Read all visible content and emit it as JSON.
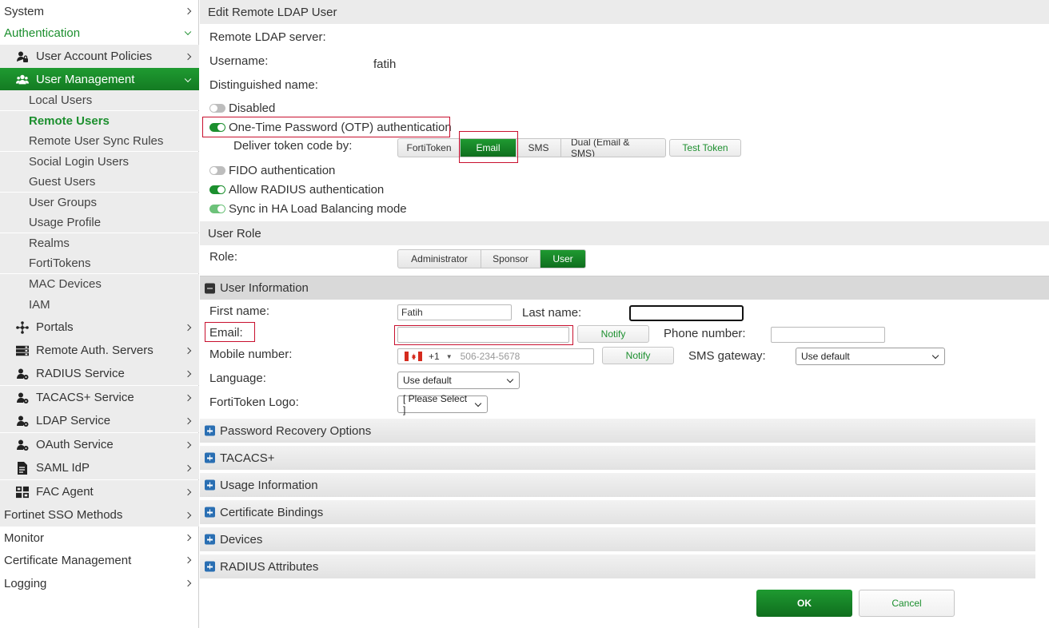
{
  "sidebar": {
    "system": "System",
    "authentication": "Authentication",
    "user_account_policies": "User Account Policies",
    "user_management": "User Management",
    "leaves": [
      "Local Users",
      "Remote Users",
      "Remote User Sync Rules",
      "Social Login Users",
      "Guest Users",
      "User Groups",
      "Usage Profile",
      "Realms",
      "FortiTokens",
      "MAC Devices",
      "IAM"
    ],
    "subs": [
      "Portals",
      "Remote Auth. Servers",
      "RADIUS Service",
      "TACACS+ Service",
      "LDAP Service",
      "OAuth Service",
      "SAML IdP",
      "FAC Agent"
    ],
    "bottom": [
      "Fortinet SSO Methods",
      "Monitor",
      "Certificate Management",
      "Logging"
    ]
  },
  "form": {
    "title": "Edit Remote LDAP User",
    "remote_ldap_server_label": "Remote LDAP server:",
    "username_label": "Username:",
    "username_value": "fatih",
    "dn_label": "Distinguished name:",
    "disabled_label": "Disabled",
    "otp_label": "One-Time Password (OTP) authentication",
    "deliver_label": "Deliver token code by:",
    "deliver_options": [
      "FortiToken",
      "Email",
      "SMS",
      "Dual (Email & SMS)"
    ],
    "deliver_selected": "Email",
    "test_token": "Test Token",
    "fido_label": "FIDO authentication",
    "radius_label": "Allow RADIUS authentication",
    "ha_label": "Sync in HA Load Balancing mode"
  },
  "role": {
    "header": "User Role",
    "label": "Role:",
    "options": [
      "Administrator",
      "Sponsor",
      "User"
    ],
    "selected": "User"
  },
  "userinfo": {
    "header": "User Information",
    "first_name_label": "First name:",
    "first_name_value": "Fatih",
    "last_name_label": "Last name:",
    "last_name_value": "",
    "email_label": "Email:",
    "email_value": "",
    "notify": "Notify",
    "phone_label": "Phone number:",
    "phone_value": "",
    "mobile_label": "Mobile number:",
    "country_code": "+1",
    "mobile_placeholder": "506-234-5678",
    "sms_gateway_label": "SMS gateway:",
    "sms_gateway_value": "Use default",
    "language_label": "Language:",
    "language_value": "Use default",
    "logo_label": "FortiToken Logo:",
    "logo_value": "[ Please Select ]"
  },
  "sections": [
    "Password Recovery Options",
    "TACACS+",
    "Usage Information",
    "Certificate Bindings",
    "Devices",
    "RADIUS Attributes"
  ],
  "footer": {
    "ok": "OK",
    "cancel": "Cancel"
  },
  "colors": {
    "accent": "#1c8f2e",
    "highlight": "#c8102e",
    "section_icon": "#2a6fb3"
  }
}
